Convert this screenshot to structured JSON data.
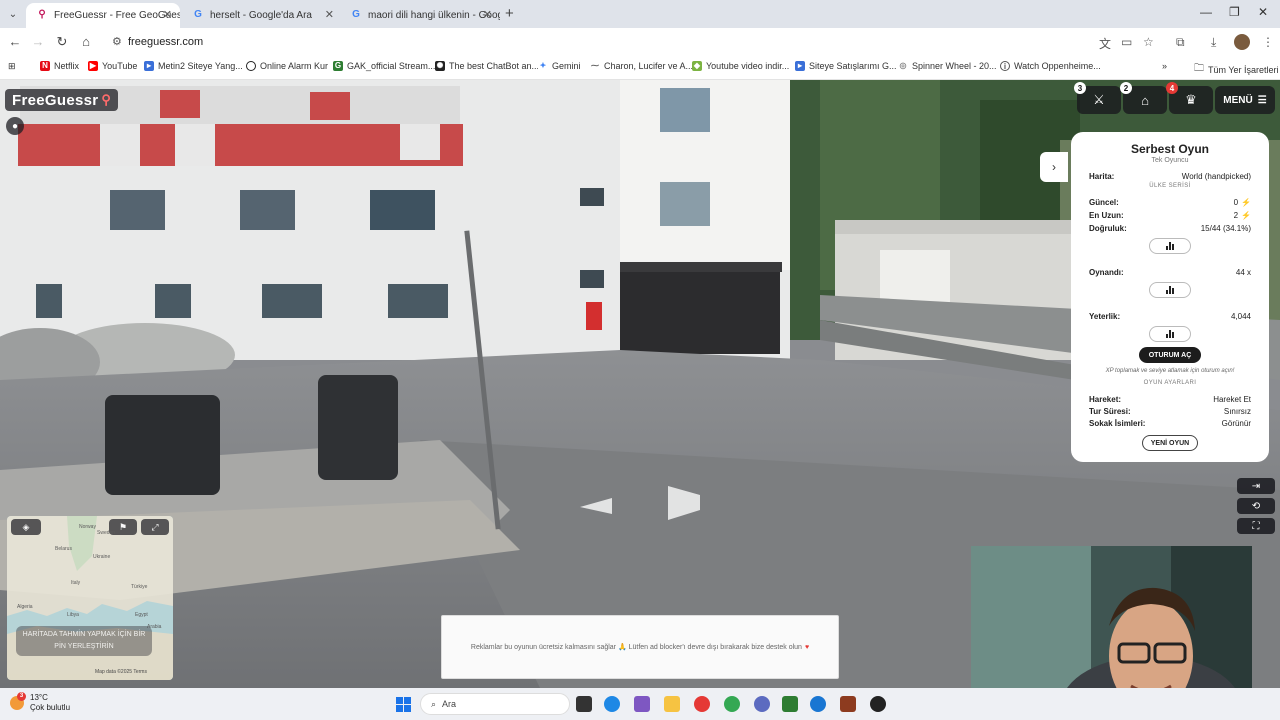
{
  "browser": {
    "tabs": [
      {
        "title": "FreeGuessr - Free GeoGuessr A",
        "active": true
      },
      {
        "title": "herselt - Google'da Ara",
        "active": false
      },
      {
        "title": "maori dili hangi ülkenin - Goog",
        "active": false
      }
    ],
    "url": "freeguessr.com",
    "bookmarks": [
      {
        "label": "Netflix",
        "icon": "netflix-icon",
        "color": "#e50914"
      },
      {
        "label": "YouTube",
        "icon": "youtube-icon",
        "color": "#ff0000"
      },
      {
        "label": "Metin2 Siteye Yang...",
        "icon": "bookmark-icon",
        "color": "#3a6fd8"
      },
      {
        "label": "Online Alarm Kur",
        "icon": "clock-icon",
        "color": "#222222"
      },
      {
        "label": "GAK_official Stream...",
        "icon": "twitch-icon",
        "color": "#2e7d32"
      },
      {
        "label": "The best ChatBot an...",
        "icon": "chatgpt-icon",
        "color": "#222222"
      },
      {
        "label": "Gemini",
        "icon": "gemini-icon",
        "color": "#4285f4"
      },
      {
        "label": "Charon, Lucifer ve A...",
        "icon": "web-icon",
        "color": "#666666"
      },
      {
        "label": "Youtube video indir...",
        "icon": "download-icon",
        "color": "#7cb342"
      },
      {
        "label": "Siteye Satışlarımı G...",
        "icon": "bookmark-icon",
        "color": "#3a6fd8"
      },
      {
        "label": "Spinner Wheel - 20...",
        "icon": "spinner-icon",
        "color": "#888888"
      },
      {
        "label": "Watch Oppenheime...",
        "icon": "web-icon",
        "color": "#555555"
      }
    ],
    "all_bookmarks": "Tüm Yer İşaretleri"
  },
  "game": {
    "logo": "FreeGuessr",
    "top_icons": [
      {
        "icon": "swords-icon",
        "count": "3",
        "red": false
      },
      {
        "icon": "store-icon",
        "count": "2",
        "red": false
      },
      {
        "icon": "trophy-icon",
        "count": "4",
        "red": true
      }
    ],
    "menu_label": "MENÜ",
    "panel": {
      "title": "Serbest Oyun",
      "subtitle": "Tek Oyuncu",
      "map_label": "Harita:",
      "map_value": "World (handpicked)",
      "section_series": "ÜLKE SERİSİ",
      "current_label": "Güncel:",
      "current_value": "0",
      "longest_label": "En Uzun:",
      "longest_value": "2",
      "accuracy_label": "Doğruluk:",
      "accuracy_value": "15/44 (34.1%)",
      "played_label": "Oynandı:",
      "played_value": "44 x",
      "skill_label": "Yeterlik:",
      "skill_value": "4,044",
      "login_button": "OTURUM AÇ",
      "login_note": "XP toplamak ve seviye atlamak için oturum açın!",
      "section_settings": "OYUN AYARLARI",
      "move_label": "Hareket:",
      "move_value": "Hareket Et",
      "time_label": "Tur Süresi:",
      "time_value": "Sınırsız",
      "street_label": "Sokak İsimleri:",
      "street_value": "Görünür",
      "new_game_button": "YENİ OYUN"
    },
    "minimap": {
      "place_hint": "HARİTADA TAHMİN YAPMAK İÇİN BİR PİN YERLEŞTİRİN",
      "labels": [
        "Norway",
        "Sweden",
        "Belarus",
        "Ukraine",
        "Türkiye",
        "Egypt",
        "Algeria",
        "Libya",
        "Arabia",
        "Italy"
      ],
      "footer": "Map data ©2025  Terms"
    },
    "ad_text": "Reklamlar bu oyunun ücretsiz kalmasını sağlar 🙏 Lütfen ad blocker'ı devre dışı bırakarak bize destek olun",
    "colors": {
      "brand_pin": "#ff6b6b",
      "badge_red": "#e53935",
      "bolt": "#f0b400"
    }
  },
  "taskbar": {
    "temperature": "13°C",
    "weather": "Çok bulutlu",
    "weather_badge": "3",
    "search_label": "Ara"
  }
}
